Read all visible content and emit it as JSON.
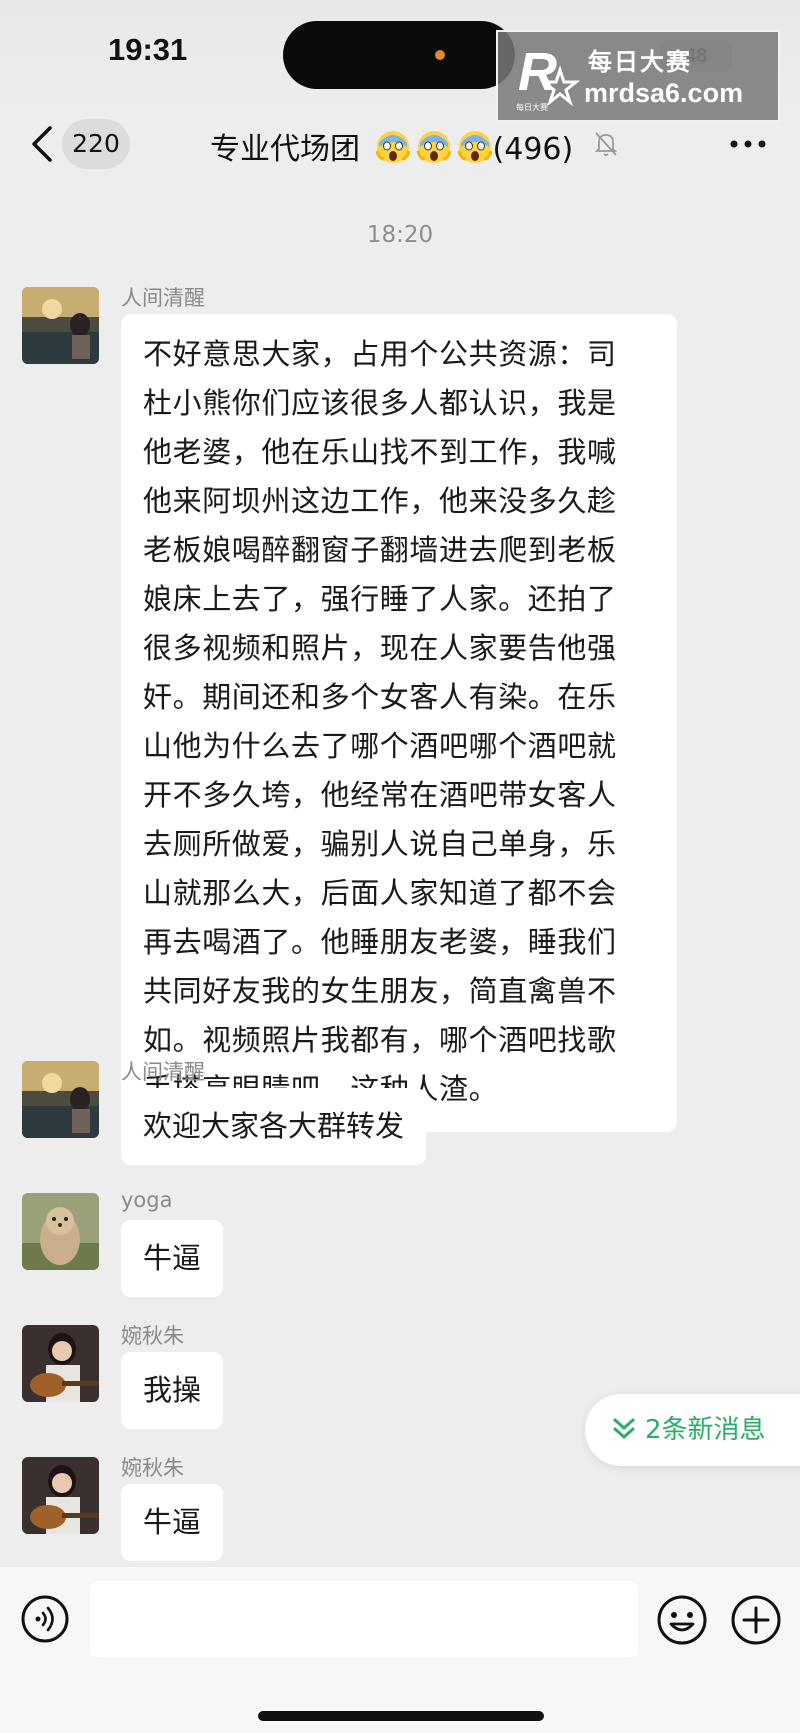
{
  "status_bar": {
    "time": "19:31",
    "battery": "48"
  },
  "watermark": {
    "title": "每日大赛",
    "url": "mrdsa6.com",
    "small": "每日大赛"
  },
  "nav": {
    "unread_count": "220",
    "title": "专业代场团",
    "member_count": "(496)",
    "icons": [
      "back-chevron-icon",
      "scream-emoji-icon",
      "mute-bell-icon",
      "more-dots-icon"
    ]
  },
  "timestamp": "18:20",
  "messages": [
    {
      "sender": "人间清醒",
      "lines": [
        "不好意思大家，占用个公共资源：司",
        "杜小熊你们应该很多人都认识，我是",
        "他老婆，他在乐山找不到工作，我喊",
        "他来阿坝州这边工作，他来没多久趁",
        "老板娘喝醉翻窗子翻墙进去爬到老板",
        "娘床上去了，强行睡了人家。还拍了",
        "很多视频和照片，现在人家要告他强",
        "奸。期间还和多个女客人有染。在乐",
        "山他为什么去了哪个酒吧哪个酒吧就",
        "开不多久垮，他经常在酒吧带女客人",
        "去厕所做爱，骗别人说自己单身，乐",
        "山就那么大，后面人家知道了都不会",
        "再去喝酒了。他睡朋友老婆，睡我们",
        "共同好友我的女生朋友，简直禽兽不",
        "如。视频照片我都有，哪个酒吧找歌",
        "手搽亮眼睛吧。这种人渣。"
      ]
    },
    {
      "sender": "人间清醒",
      "text": "欢迎大家各大群转发"
    },
    {
      "sender": "yoga",
      "text": "牛逼"
    },
    {
      "sender": "婉秋朱",
      "text": "我操"
    },
    {
      "sender": "婉秋朱",
      "text": "牛逼"
    }
  ],
  "new_messages_label": "2条新消息",
  "input_bar": {
    "placeholder": "",
    "icons": [
      "voice-icon",
      "emoji-icon",
      "plus-icon"
    ]
  },
  "colors": {
    "background": "#ededed",
    "bubble": "#ffffff",
    "accent_green": "#2aae67"
  }
}
